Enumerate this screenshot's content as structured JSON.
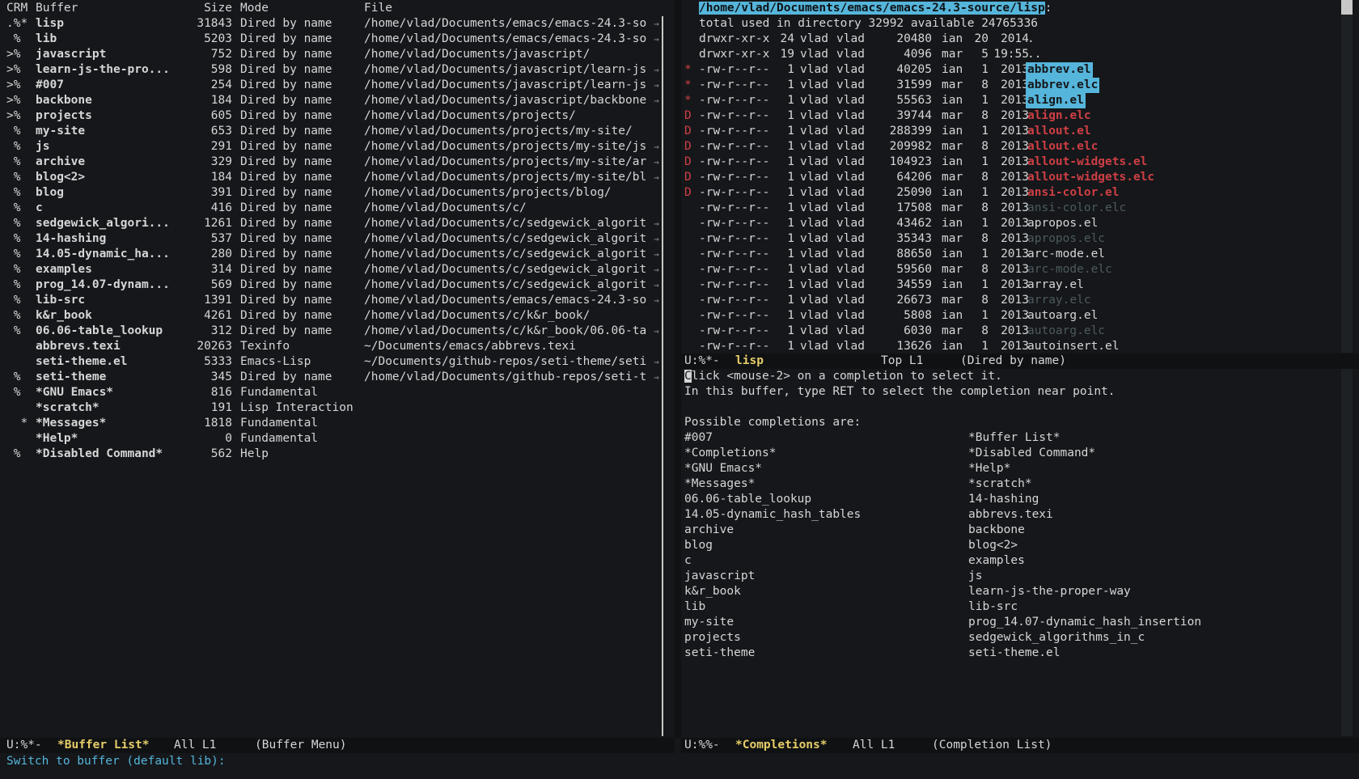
{
  "buffer_list": {
    "header": {
      "crm": "CRM",
      "buffer": "Buffer",
      "size": "Size",
      "mode": "Mode",
      "file": "File"
    },
    "rows": [
      {
        "crm": ".%*",
        "name": "lisp",
        "size": "31843",
        "mode": "Dired by name",
        "file": "/home/vlad/Documents/emacs/emacs-24.3-so"
      },
      {
        "crm": " % ",
        "name": "lib",
        "size": "5203",
        "mode": "Dired by name",
        "file": "/home/vlad/Documents/emacs/emacs-24.3-so"
      },
      {
        "crm": ">% ",
        "name": "javascript",
        "size": "752",
        "mode": "Dired by name",
        "file": "/home/vlad/Documents/javascript/"
      },
      {
        "crm": ">% ",
        "name": "learn-js-the-pro...",
        "size": "598",
        "mode": "Dired by name",
        "file": "/home/vlad/Documents/javascript/learn-js"
      },
      {
        "crm": ">% ",
        "name": "#007",
        "size": "254",
        "mode": "Dired by name",
        "file": "/home/vlad/Documents/javascript/learn-js"
      },
      {
        "crm": ">% ",
        "name": "backbone",
        "size": "184",
        "mode": "Dired by name",
        "file": "/home/vlad/Documents/javascript/backbone"
      },
      {
        "crm": ">% ",
        "name": "projects",
        "size": "605",
        "mode": "Dired by name",
        "file": "/home/vlad/Documents/projects/"
      },
      {
        "crm": " % ",
        "name": "my-site",
        "size": "653",
        "mode": "Dired by name",
        "file": "/home/vlad/Documents/projects/my-site/"
      },
      {
        "crm": " % ",
        "name": "js",
        "size": "291",
        "mode": "Dired by name",
        "file": "/home/vlad/Documents/projects/my-site/js"
      },
      {
        "crm": " % ",
        "name": "archive",
        "size": "329",
        "mode": "Dired by name",
        "file": "/home/vlad/Documents/projects/my-site/ar"
      },
      {
        "crm": " % ",
        "name": "blog<2>",
        "size": "184",
        "mode": "Dired by name",
        "file": "/home/vlad/Documents/projects/my-site/bl"
      },
      {
        "crm": " % ",
        "name": "blog",
        "size": "391",
        "mode": "Dired by name",
        "file": "/home/vlad/Documents/projects/blog/"
      },
      {
        "crm": " % ",
        "name": "c",
        "size": "416",
        "mode": "Dired by name",
        "file": "/home/vlad/Documents/c/"
      },
      {
        "crm": " % ",
        "name": "sedgewick_algori...",
        "size": "1261",
        "mode": "Dired by name",
        "file": "/home/vlad/Documents/c/sedgewick_algorit"
      },
      {
        "crm": " % ",
        "name": "14-hashing",
        "size": "537",
        "mode": "Dired by name",
        "file": "/home/vlad/Documents/c/sedgewick_algorit"
      },
      {
        "crm": " % ",
        "name": "14.05-dynamic_ha...",
        "size": "280",
        "mode": "Dired by name",
        "file": "/home/vlad/Documents/c/sedgewick_algorit"
      },
      {
        "crm": " % ",
        "name": "examples",
        "size": "314",
        "mode": "Dired by name",
        "file": "/home/vlad/Documents/c/sedgewick_algorit"
      },
      {
        "crm": " % ",
        "name": "prog_14.07-dynam...",
        "size": "569",
        "mode": "Dired by name",
        "file": "/home/vlad/Documents/c/sedgewick_algorit"
      },
      {
        "crm": " % ",
        "name": "lib-src",
        "size": "1391",
        "mode": "Dired by name",
        "file": "/home/vlad/Documents/emacs/emacs-24.3-so"
      },
      {
        "crm": " % ",
        "name": "k&r_book",
        "size": "4261",
        "mode": "Dired by name",
        "file": "/home/vlad/Documents/c/k&r_book/"
      },
      {
        "crm": " % ",
        "name": "06.06-table_lookup",
        "size": "312",
        "mode": "Dired by name",
        "file": "/home/vlad/Documents/c/k&r_book/06.06-ta"
      },
      {
        "crm": "   ",
        "name": "abbrevs.texi",
        "size": "20263",
        "mode": "Texinfo",
        "file": "~/Documents/emacs/abbrevs.texi"
      },
      {
        "crm": "   ",
        "name": "seti-theme.el",
        "size": "5333",
        "mode": "Emacs-Lisp",
        "file": "~/Documents/github-repos/seti-theme/seti"
      },
      {
        "crm": " % ",
        "name": "seti-theme",
        "size": "345",
        "mode": "Dired by name",
        "file": "/home/vlad/Documents/github-repos/seti-t"
      },
      {
        "crm": " % ",
        "name": "*GNU Emacs*",
        "size": "816",
        "mode": "Fundamental",
        "file": ""
      },
      {
        "crm": "   ",
        "name": "*scratch*",
        "size": "191",
        "mode": "Lisp Interaction",
        "file": ""
      },
      {
        "crm": "  *",
        "name": "*Messages*",
        "size": "1818",
        "mode": "Fundamental",
        "file": ""
      },
      {
        "crm": "   ",
        "name": "*Help*",
        "size": "0",
        "mode": "Fundamental",
        "file": ""
      },
      {
        "crm": " % ",
        "name": "*Disabled Command*",
        "size": "562",
        "mode": "Help",
        "file": ""
      }
    ],
    "modeline": {
      "status": "U:%*-",
      "name": "*Buffer List*",
      "pos": "All L1",
      "mode": "(Buffer Menu)"
    }
  },
  "dired": {
    "path": "/home/vlad/Documents/emacs/emacs-24.3-source/lisp",
    "path_suffix": ":",
    "summary": "total used in directory 32992 available 24765336",
    "entries": [
      {
        "mark": " ",
        "perms": "drwxr-xr-x",
        "links": "24",
        "owner": "vlad",
        "group": "vlad",
        "size": "20480",
        "month": "ian",
        "day": "20",
        "time": "2014",
        "name": ".",
        "style": "plain"
      },
      {
        "mark": " ",
        "perms": "drwxr-xr-x",
        "links": "19",
        "owner": "vlad",
        "group": "vlad",
        "size": "4096",
        "month": "mar",
        "day": "5",
        "time": "19:55",
        "name": "..",
        "style": "plain"
      },
      {
        "mark": "*",
        "perms": "-rw-r--r--",
        "links": "1",
        "owner": "vlad",
        "group": "vlad",
        "size": "40205",
        "month": "ian",
        "day": "1",
        "time": "2013",
        "name": "abbrev.el",
        "style": "marked"
      },
      {
        "mark": "*",
        "perms": "-rw-r--r--",
        "links": "1",
        "owner": "vlad",
        "group": "vlad",
        "size": "31599",
        "month": "mar",
        "day": "8",
        "time": "2013",
        "name": "abbrev.elc",
        "style": "marked"
      },
      {
        "mark": "*",
        "perms": "-rw-r--r--",
        "links": "1",
        "owner": "vlad",
        "group": "vlad",
        "size": "55563",
        "month": "ian",
        "day": "1",
        "time": "2013",
        "name": "align.el",
        "style": "marked"
      },
      {
        "mark": "D",
        "perms": "-rw-r--r--",
        "links": "1",
        "owner": "vlad",
        "group": "vlad",
        "size": "39744",
        "month": "mar",
        "day": "8",
        "time": "2013",
        "name": "align.elc",
        "style": "deleted"
      },
      {
        "mark": "D",
        "perms": "-rw-r--r--",
        "links": "1",
        "owner": "vlad",
        "group": "vlad",
        "size": "288399",
        "month": "ian",
        "day": "1",
        "time": "2013",
        "name": "allout.el",
        "style": "deleted"
      },
      {
        "mark": "D",
        "perms": "-rw-r--r--",
        "links": "1",
        "owner": "vlad",
        "group": "vlad",
        "size": "209982",
        "month": "mar",
        "day": "8",
        "time": "2013",
        "name": "allout.elc",
        "style": "deleted"
      },
      {
        "mark": "D",
        "perms": "-rw-r--r--",
        "links": "1",
        "owner": "vlad",
        "group": "vlad",
        "size": "104923",
        "month": "ian",
        "day": "1",
        "time": "2013",
        "name": "allout-widgets.el",
        "style": "deleted"
      },
      {
        "mark": "D",
        "perms": "-rw-r--r--",
        "links": "1",
        "owner": "vlad",
        "group": "vlad",
        "size": "64206",
        "month": "mar",
        "day": "8",
        "time": "2013",
        "name": "allout-widgets.elc",
        "style": "deleted"
      },
      {
        "mark": "D",
        "perms": "-rw-r--r--",
        "links": "1",
        "owner": "vlad",
        "group": "vlad",
        "size": "25090",
        "month": "ian",
        "day": "1",
        "time": "2013",
        "name": "ansi-color.el",
        "style": "deleted"
      },
      {
        "mark": " ",
        "perms": "-rw-r--r--",
        "links": "1",
        "owner": "vlad",
        "group": "vlad",
        "size": "17508",
        "month": "mar",
        "day": "8",
        "time": "2013",
        "name": "ansi-color.elc",
        "style": "dim"
      },
      {
        "mark": " ",
        "perms": "-rw-r--r--",
        "links": "1",
        "owner": "vlad",
        "group": "vlad",
        "size": "43462",
        "month": "ian",
        "day": "1",
        "time": "2013",
        "name": "apropos.el",
        "style": "plain"
      },
      {
        "mark": " ",
        "perms": "-rw-r--r--",
        "links": "1",
        "owner": "vlad",
        "group": "vlad",
        "size": "35343",
        "month": "mar",
        "day": "8",
        "time": "2013",
        "name": "apropos.elc",
        "style": "dim"
      },
      {
        "mark": " ",
        "perms": "-rw-r--r--",
        "links": "1",
        "owner": "vlad",
        "group": "vlad",
        "size": "88650",
        "month": "ian",
        "day": "1",
        "time": "2013",
        "name": "arc-mode.el",
        "style": "plain"
      },
      {
        "mark": " ",
        "perms": "-rw-r--r--",
        "links": "1",
        "owner": "vlad",
        "group": "vlad",
        "size": "59560",
        "month": "mar",
        "day": "8",
        "time": "2013",
        "name": "arc-mode.elc",
        "style": "dim"
      },
      {
        "mark": " ",
        "perms": "-rw-r--r--",
        "links": "1",
        "owner": "vlad",
        "group": "vlad",
        "size": "34559",
        "month": "ian",
        "day": "1",
        "time": "2013",
        "name": "array.el",
        "style": "plain"
      },
      {
        "mark": " ",
        "perms": "-rw-r--r--",
        "links": "1",
        "owner": "vlad",
        "group": "vlad",
        "size": "26673",
        "month": "mar",
        "day": "8",
        "time": "2013",
        "name": "array.elc",
        "style": "dim"
      },
      {
        "mark": " ",
        "perms": "-rw-r--r--",
        "links": "1",
        "owner": "vlad",
        "group": "vlad",
        "size": "5808",
        "month": "ian",
        "day": "1",
        "time": "2013",
        "name": "autoarg.el",
        "style": "plain"
      },
      {
        "mark": " ",
        "perms": "-rw-r--r--",
        "links": "1",
        "owner": "vlad",
        "group": "vlad",
        "size": "6030",
        "month": "mar",
        "day": "8",
        "time": "2013",
        "name": "autoarg.elc",
        "style": "dim"
      },
      {
        "mark": " ",
        "perms": "-rw-r--r--",
        "links": "1",
        "owner": "vlad",
        "group": "vlad",
        "size": "13626",
        "month": "ian",
        "day": "1",
        "time": "2013",
        "name": "autoinsert.el",
        "style": "plain"
      }
    ],
    "modeline": {
      "status": "U:%*-",
      "name": "lisp",
      "pos": "Top L1",
      "mode": "(Dired by name)"
    }
  },
  "completions": {
    "line1_cursor": "C",
    "line1_rest": "lick <mouse-2> on a completion to select it.",
    "line2": "In this buffer, type RET to select the completion near point.",
    "line3": "Possible completions are:",
    "left": [
      "#007",
      "*Completions*",
      "*GNU Emacs*",
      "*Messages*",
      "06.06-table_lookup",
      "14.05-dynamic_hash_tables",
      "archive",
      "blog",
      "c",
      "javascript",
      "k&r_book",
      "lib",
      "my-site",
      "projects",
      "seti-theme"
    ],
    "right": [
      "*Buffer List*",
      "*Disabled Command*",
      "*Help*",
      "*scratch*",
      "14-hashing",
      "abbrevs.texi",
      "backbone",
      "blog<2>",
      "examples",
      "js",
      "learn-js-the-proper-way",
      "lib-src",
      "prog_14.07-dynamic_hash_insertion",
      "sedgewick_algorithms_in_c",
      "seti-theme.el"
    ],
    "modeline": {
      "status": "U:%%-",
      "name": "*Completions*",
      "pos": "All L1",
      "mode": "(Completion List)"
    }
  },
  "minibuffer": {
    "prompt": "Switch to buffer (default lib): "
  },
  "icons": {
    "truncation": "right-arrow-icon"
  },
  "colors": {
    "background": "#15171a",
    "accent": "#55b5db",
    "modeline_name": "#e6cd69",
    "deleted": "#cd3f45",
    "dim": "#4d5a5e"
  }
}
